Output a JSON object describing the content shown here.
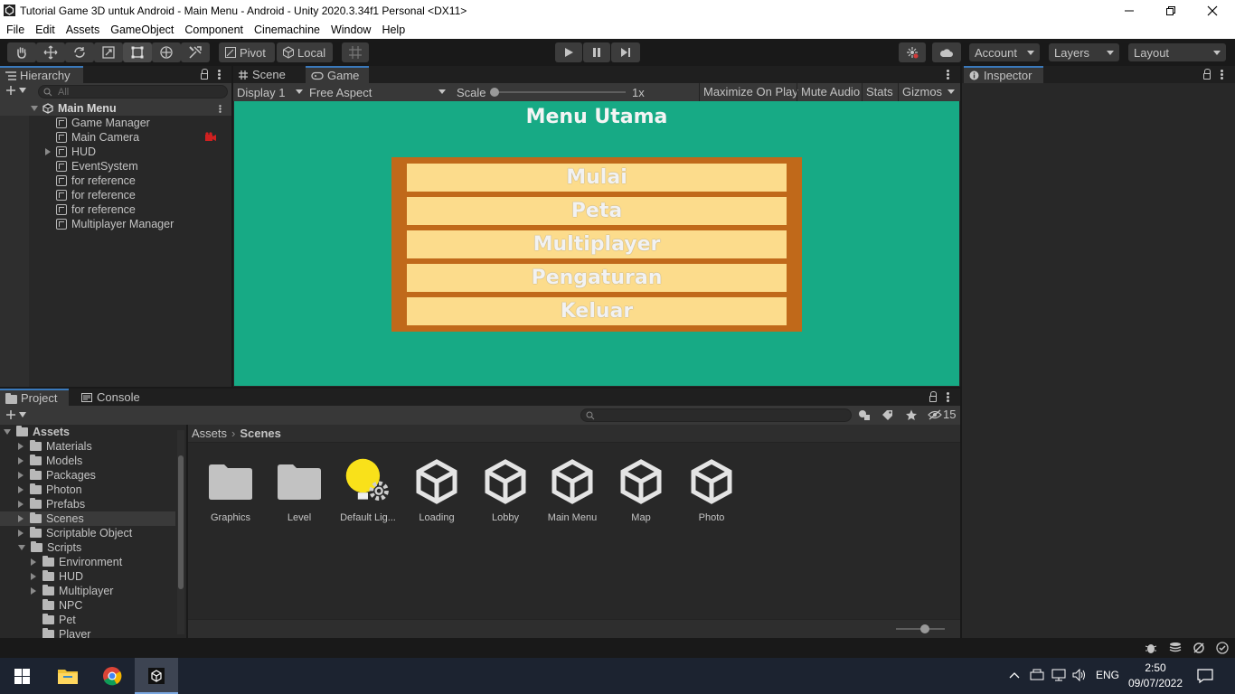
{
  "window": {
    "title": "Tutorial Game 3D untuk Android - Main Menu - Android - Unity 2020.3.34f1 Personal <DX11>"
  },
  "menubar": [
    "File",
    "Edit",
    "Assets",
    "GameObject",
    "Component",
    "Cinemachine",
    "Window",
    "Help"
  ],
  "toolbar": {
    "pivot_label": "Pivot",
    "local_label": "Local",
    "account_label": "Account",
    "layers_label": "Layers",
    "layout_label": "Layout"
  },
  "hierarchy": {
    "tab_label": "Hierarchy",
    "search_placeholder": "All",
    "scene_name": "Main Menu",
    "items": [
      {
        "label": "Game Manager"
      },
      {
        "label": "Main Camera"
      },
      {
        "label": "HUD"
      },
      {
        "label": "EventSystem"
      },
      {
        "label": "for reference"
      },
      {
        "label": "for reference"
      },
      {
        "label": "for reference"
      },
      {
        "label": "Multiplayer Manager"
      }
    ]
  },
  "center_tabs": {
    "scene_label": "Scene",
    "game_label": "Game"
  },
  "game_toolbar": {
    "display": "Display 1",
    "aspect": "Free Aspect",
    "scale_label": "Scale",
    "scale_value": "1x",
    "scale_fraction": 0.0,
    "maximize": "Maximize On Play",
    "mute": "Mute Audio",
    "stats": "Stats",
    "gizmos": "Gizmos"
  },
  "game": {
    "title": "Menu Utama",
    "buttons": [
      "Mulai",
      "Peta",
      "Multiplayer",
      "Pengaturan",
      "Keluar"
    ],
    "bg_color": "#17aa85",
    "frame_color": "#c0691a",
    "button_color": "#fcdc8c"
  },
  "inspector": {
    "tab_label": "Inspector"
  },
  "project": {
    "tab_label": "Project",
    "console_label": "Console",
    "hidden_count": "15",
    "breadcrumb": [
      "Assets",
      "Scenes"
    ],
    "tree": {
      "root": "Assets",
      "items": [
        "Materials",
        "Models",
        "Packages",
        "Photon",
        "Prefabs",
        "Scenes",
        "Scriptable Object",
        "Scripts"
      ],
      "scripts_children": [
        "Environment",
        "HUD",
        "Multiplayer",
        "NPC",
        "Pet",
        "Player"
      ]
    },
    "assets": [
      {
        "label": "Graphics",
        "icon": "folder-icon"
      },
      {
        "label": "Level",
        "icon": "folder-icon"
      },
      {
        "label": "Default Lig...",
        "icon": "lighting-settings-icon"
      },
      {
        "label": "Loading",
        "icon": "unity-scene-icon"
      },
      {
        "label": "Lobby",
        "icon": "unity-scene-icon"
      },
      {
        "label": "Main Menu",
        "icon": "unity-scene-icon"
      },
      {
        "label": "Map",
        "icon": "unity-scene-icon"
      },
      {
        "label": "Photo",
        "icon": "unity-scene-icon"
      }
    ]
  },
  "taskbar": {
    "time": "2:50",
    "date": "09/07/2022",
    "lang": "ENG"
  }
}
